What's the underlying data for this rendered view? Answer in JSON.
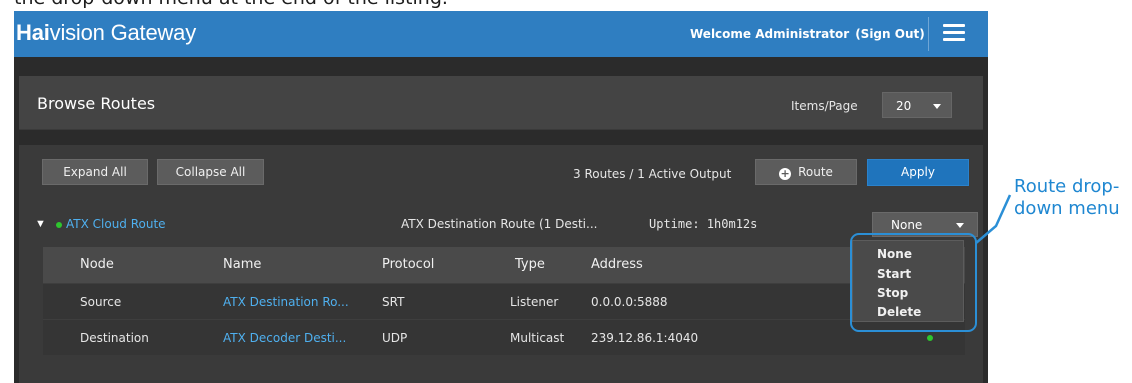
{
  "caption": "the drop-down menu at the end of the listing.",
  "header": {
    "brand_bold": "Hai",
    "brand_rest": "vision Gateway",
    "welcome": "Welcome Administrator",
    "sign_out": "(Sign Out)",
    "menu_icon": "hamburger-icon",
    "bar_color": "#2f7ec1"
  },
  "browse": {
    "title": "Browse Routes",
    "items_per_page_label": "Items/Page",
    "items_per_page_value": "20"
  },
  "toolbar": {
    "expand_all": "Expand All",
    "collapse_all": "Collapse All",
    "summary": "3 Routes / 1 Active Output",
    "add_route": "Route",
    "apply": "Apply",
    "apply_color": "#1f74bc"
  },
  "route": {
    "name": "ATX Cloud Route",
    "destination_summary": "ATX Destination Route (1 Desti...",
    "uptime": "Uptime: 1h0m12s",
    "action_value": "None",
    "status_color": "#2ec52e",
    "link_color": "#4fb0ef"
  },
  "table": {
    "columns": [
      "Node",
      "Name",
      "Protocol",
      "Type",
      "Address"
    ],
    "rows": [
      {
        "node": "Source",
        "name": "ATX Destination Ro...",
        "protocol": "SRT",
        "type": "Listener",
        "address": "0.0.0.0:5888",
        "active": false
      },
      {
        "node": "Destination",
        "name": "ATX Decoder Desti...",
        "protocol": "UDP",
        "type": "Multicast",
        "address": "239.12.86.1:4040",
        "active": true
      }
    ]
  },
  "dropdown": {
    "options": [
      "None",
      "Start",
      "Stop",
      "Delete"
    ]
  },
  "callout": {
    "line1": "Route drop-",
    "line2": "down menu",
    "color": "#2b8fd6"
  }
}
